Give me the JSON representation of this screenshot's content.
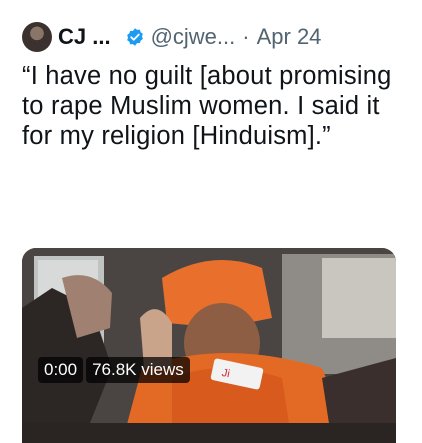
{
  "tweet": {
    "author_name": "CJ ...",
    "handle": "@cjwe...",
    "separator": "·",
    "date": "Apr 24",
    "text": "“I have no guilt [about promising to rape Muslim women. I said it for my religion [Hinduism].”"
  },
  "video": {
    "time": "0:00",
    "views": "76.8K views",
    "sign_text": "Ji"
  },
  "icons": {
    "avatar": "avatar-photo",
    "verified": "verified-badge-icon"
  },
  "colors": {
    "text": "#0f1419",
    "muted": "#536471",
    "verified": "#1d9bf0",
    "saffron": "#e8702c"
  }
}
